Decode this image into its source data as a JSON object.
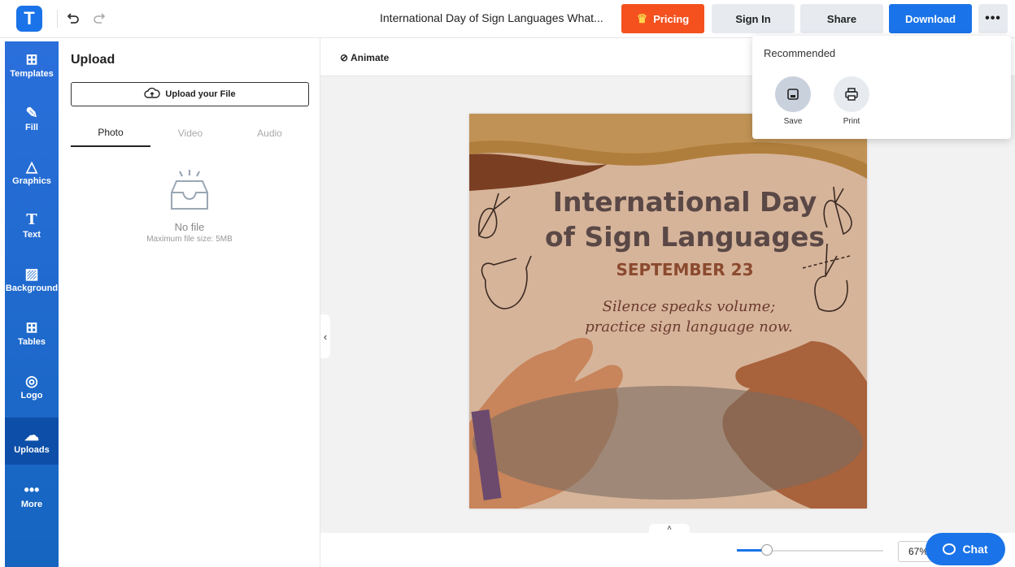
{
  "header": {
    "logo_letter": "T",
    "doc_title": "International Day of Sign Languages What...",
    "pricing_label": "Pricing",
    "signin_label": "Sign In",
    "share_label": "Share",
    "download_label": "Download",
    "more_label": "•••",
    "undo_icon": "undo-icon",
    "redo_icon": "redo-icon"
  },
  "rail": {
    "items": [
      {
        "label": "Templates",
        "icon": "templates-icon"
      },
      {
        "label": "Fill",
        "icon": "pencil-icon"
      },
      {
        "label": "Graphics",
        "icon": "shapes-icon"
      },
      {
        "label": "Text",
        "icon": "text-icon"
      },
      {
        "label": "Background",
        "icon": "background-icon"
      },
      {
        "label": "Tables",
        "icon": "table-icon"
      },
      {
        "label": "Logo",
        "icon": "logo-icon"
      },
      {
        "label": "Uploads",
        "icon": "upload-cloud-icon"
      },
      {
        "label": "More",
        "icon": "more-dots-icon"
      }
    ],
    "active": "Uploads"
  },
  "panel": {
    "title": "Upload",
    "upload_button": "Upload your File",
    "tabs": [
      "Photo",
      "Video",
      "Audio"
    ],
    "active_tab": "Photo",
    "empty_title": "No file",
    "empty_limit": "Maximum file size: 5MB"
  },
  "canvas": {
    "animate_label": "Animate",
    "design": {
      "title_line1": "International Day",
      "title_line2": "of Sign Languages",
      "date": "SEPTEMBER 23",
      "quote_line1": "Silence speaks volume;",
      "quote_line2": "practice sign language now."
    },
    "zoom": "67%",
    "chat_label": "Chat"
  },
  "dropdown": {
    "title": "Recommended",
    "items": [
      {
        "label": "Save",
        "icon": "save-icon"
      },
      {
        "label": "Print",
        "icon": "print-icon"
      }
    ]
  },
  "colors": {
    "accent": "#1a73e8",
    "pricing": "#f4511e",
    "design_bg": "#d6b49a"
  }
}
